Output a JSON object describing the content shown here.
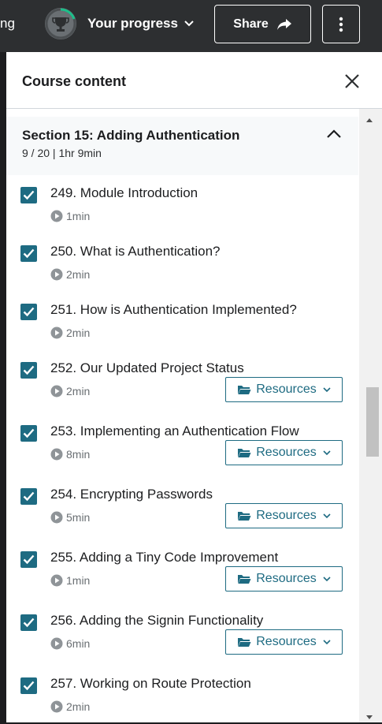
{
  "topbar": {
    "left_fragment": "ng",
    "progress_label": "Your progress",
    "share_label": "Share"
  },
  "panel": {
    "title": "Course content"
  },
  "section": {
    "title": "Section 15: Adding Authentication",
    "meta": "9 / 20 | 1hr 9min"
  },
  "resources_label": "Resources",
  "items": [
    {
      "title": "249. Module Introduction",
      "duration": "1min",
      "completed": true,
      "has_resources": false
    },
    {
      "title": "250. What is Authentication?",
      "duration": "2min",
      "completed": true,
      "has_resources": false
    },
    {
      "title": "251. How is Authentication Implemented?",
      "duration": "2min",
      "completed": true,
      "has_resources": false
    },
    {
      "title": "252. Our Updated Project Status",
      "duration": "2min",
      "completed": true,
      "has_resources": true
    },
    {
      "title": "253. Implementing an Authentication Flow",
      "duration": "8min",
      "completed": true,
      "has_resources": true
    },
    {
      "title": "254. Encrypting Passwords",
      "duration": "5min",
      "completed": true,
      "has_resources": true
    },
    {
      "title": "255. Adding a Tiny Code Improvement",
      "duration": "1min",
      "completed": true,
      "has_resources": true
    },
    {
      "title": "256. Adding the Signin Functionality",
      "duration": "6min",
      "completed": true,
      "has_resources": true
    },
    {
      "title": "257. Working on Route Protection",
      "duration": "2min",
      "completed": true,
      "has_resources": false
    }
  ],
  "colors": {
    "accent": "#1e6b82",
    "topbar": "#2d2f31",
    "section_bg": "#f7f9fa"
  },
  "icons": [
    "trophy-icon",
    "chevron-down-icon",
    "share-arrow-icon",
    "more-vertical-icon",
    "close-icon",
    "chevron-up-icon",
    "check-icon",
    "play-icon",
    "folder-icon"
  ]
}
